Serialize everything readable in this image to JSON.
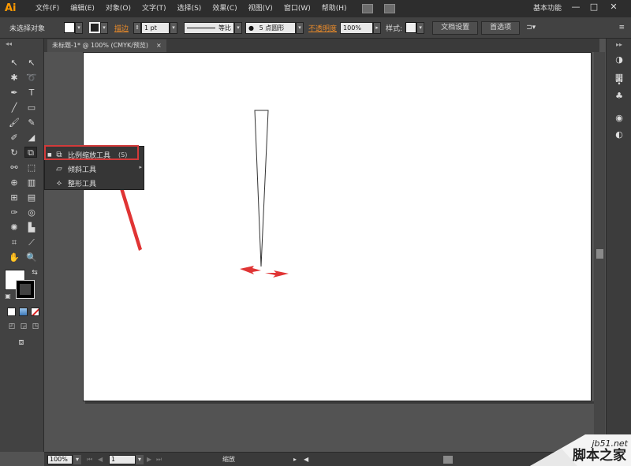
{
  "app": {
    "logo": "Ai"
  },
  "menu": [
    "文件(F)",
    "编辑(E)",
    "对象(O)",
    "文字(T)",
    "选择(S)",
    "效果(C)",
    "视图(V)",
    "窗口(W)",
    "帮助(H)"
  ],
  "workspace": "基本功能",
  "window_controls": [
    "—",
    "□",
    "✕"
  ],
  "control_bar": {
    "selection": "未选择对象",
    "stroke_label": "描边",
    "stroke_weight": "1 pt",
    "profile": "等比",
    "brush": "5 点圆形",
    "opacity_label": "不透明度",
    "opacity": "100%",
    "style_label": "样式:",
    "doc_setup": "文档设置",
    "prefs": "首选项"
  },
  "document_tab": {
    "title": "未标题-1* @ 100% (CMYK/预览)",
    "close": "×"
  },
  "flyout": {
    "items": [
      {
        "label": "比例缩放工具",
        "shortcut": "(S)",
        "icon": "scale-icon"
      },
      {
        "label": "倾斜工具",
        "shortcut": "",
        "icon": "shear-icon"
      },
      {
        "label": "整形工具",
        "shortcut": "",
        "icon": "reshape-icon"
      }
    ]
  },
  "status_bar": {
    "zoom": "100%",
    "artboard_number": "1",
    "tool_name": "缩放"
  },
  "watermark": {
    "site": "jb51.net",
    "name": "脚本之家"
  },
  "colors": {
    "accent": "#e88a2a",
    "highlight": "#d23a3a",
    "ai_logo": "#ff9a00"
  }
}
